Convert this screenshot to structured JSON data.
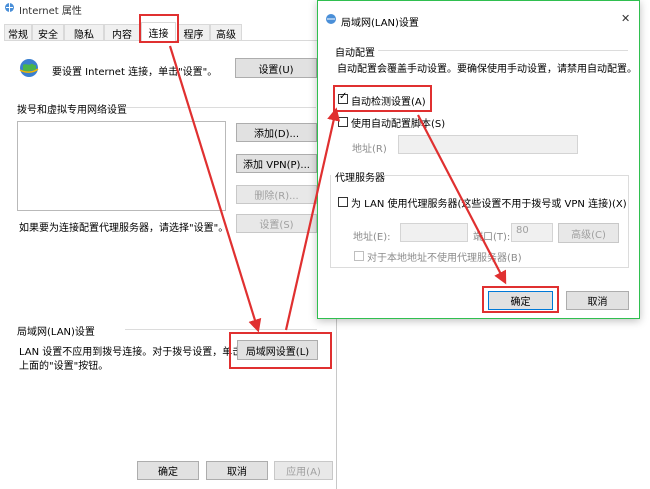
{
  "main_window": {
    "title": "Internet 属性",
    "tabs": [
      "常规",
      "安全",
      "隐私",
      "内容",
      "连接",
      "程序",
      "高级"
    ],
    "active_tab": "连接",
    "setup_text": "要设置 Internet 连接，单击\"设置\"。",
    "setup_button": "设置(U)",
    "dialup_section_label": "拨号和虚拟专用网络设置",
    "add_button": "添加(D)...",
    "add_vpn_button": "添加 VPN(P)...",
    "remove_button": "删除(R)...",
    "proxy_hint": "如果要为连接配置代理服务器，请选择\"设置\"。",
    "settings_button": "设置(S)",
    "lan_section_label": "局域网(LAN)设置",
    "lan_desc_line1": "LAN 设置不应用到拨号连接。对于拨号设置，单击",
    "lan_desc_line2": "上面的\"设置\"按钮。",
    "lan_button": "局域网设置(L)",
    "ok_button": "确定",
    "cancel_button": "取消",
    "apply_button": "应用(A)"
  },
  "lan_dialog": {
    "title": "局域网(LAN)设置",
    "close_glyph": "✕",
    "auto_config_label": "自动配置",
    "auto_config_desc": "自动配置会覆盖手动设置。要确保使用手动设置，请禁用自动配置。",
    "auto_detect_label": "自动检测设置(A)",
    "auto_detect_checked": true,
    "use_script_label": "使用自动配置脚本(S)",
    "use_script_checked": false,
    "address_label": "地址(R)",
    "proxy_section_label": "代理服务器",
    "use_proxy_label": "为 LAN 使用代理服务器(这些设置不用于拨号或 VPN 连接)(X)",
    "use_proxy_checked": false,
    "proxy_address_label": "地址(E):",
    "port_label": "端口(T):",
    "port_value": "80",
    "advanced_button": "高级(C)",
    "bypass_label": "对于本地地址不使用代理服务器(B)",
    "ok_button": "确定",
    "cancel_button": "取消"
  },
  "colors": {
    "annotation_red": "#e03030",
    "dialog_green": "#2fbf4f"
  }
}
